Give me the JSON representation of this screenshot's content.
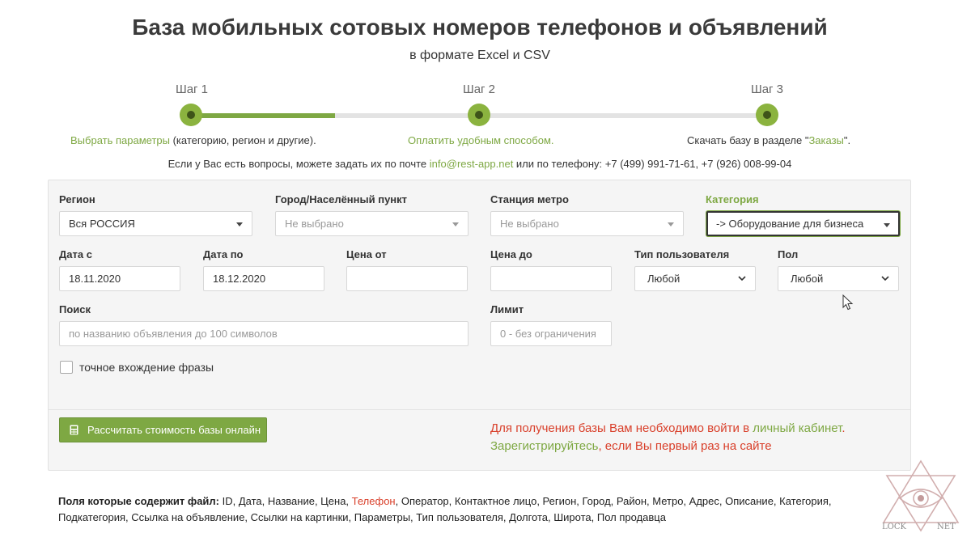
{
  "header": {
    "title": "База мобильных сотовых номеров телефонов и объявлений",
    "subtitle": "в формате Excel и CSV"
  },
  "progress": {
    "completed_fraction": 0.25
  },
  "steps": [
    {
      "label": "Шаг 1",
      "link": "Выбрать параметры",
      "text": " (категорию, регион и другие)."
    },
    {
      "label": "Шаг 2",
      "link": "Оплатить удобным способом."
    },
    {
      "label": "Шаг 3",
      "text_before": "Скачать базу в разделе \"",
      "link": "Заказы",
      "text_after": "\"."
    }
  ],
  "contact": {
    "prefix": "Если у Вас есть вопросы, можете задать их по почте ",
    "email": "info@rest-app.net",
    "suffix": " или по телефону: +7 (499) 991-71-61, +7 (926) 008-99-04"
  },
  "form": {
    "region": {
      "label": "Регион",
      "value": "Вся РОССИЯ"
    },
    "city": {
      "label": "Город/Населённый пункт",
      "value": "Не выбрано"
    },
    "metro": {
      "label": "Станция метро",
      "value": "Не выбрано"
    },
    "category": {
      "label": "Категория",
      "value": "-> Оборудование для бизнеса"
    },
    "date_from": {
      "label": "Дата с",
      "value": "18.11.2020"
    },
    "date_to": {
      "label": "Дата по",
      "value": "18.12.2020"
    },
    "price_from": {
      "label": "Цена от",
      "value": ""
    },
    "price_to": {
      "label": "Цена до",
      "value": ""
    },
    "user_type": {
      "label": "Тип пользователя",
      "value": "Любой"
    },
    "gender": {
      "label": "Пол",
      "value": "Любой"
    },
    "search": {
      "label": "Поиск",
      "placeholder": "по названию объявления до 100 символов"
    },
    "limit": {
      "label": "Лимит",
      "placeholder": "0 - без ограничения"
    },
    "exact_phrase": {
      "label": "точное вхождение фразы",
      "checked": false
    },
    "calc_button": "Рассчитать стоимость базы онлайн",
    "calc_icon": "calculator-icon"
  },
  "notice": {
    "line1_red": "Для получения базы Вам необходимо войти в ",
    "line1_link": "личный кабинет",
    "line1_end": ".",
    "line2_link": "Зарегистрируйтесь",
    "line2_red": ", если Вы первый раз на сайте"
  },
  "fields_info": {
    "label": "Поля которые содержит файл:",
    "part1": " ID, Дата, Название, Цена, ",
    "phone": "Телефон",
    "part2": ", Оператор, Контактное лицо, Регион, Город, Район, Метро, Адрес, Описание, Категория, Подкатегория, Ссылка на объявление, Ссылки на картинки, Параметры, Тип пользователя, Долгота, Широта, Пол продавца"
  },
  "watermark": {
    "text_left": "LOCK",
    "text_right": "NET",
    "icon": "eye-triangle-logo"
  },
  "colors": {
    "accent": "#7ea843",
    "alert": "#d9402b",
    "track": "#e3e3e3"
  }
}
